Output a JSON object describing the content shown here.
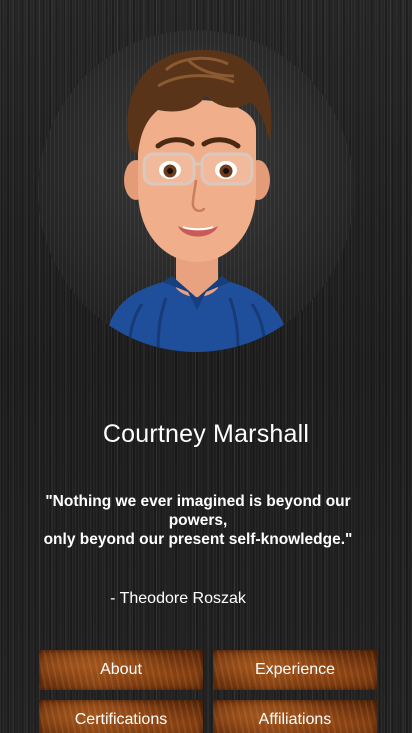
{
  "profile": {
    "name": "Courtney Marshall",
    "quote_line1": "\"Nothing we ever imagined is beyond our powers,",
    "quote_line2": "only beyond our present self-knowledge.\"",
    "author": "- Theodore Roszak"
  },
  "nav": {
    "about": "About",
    "experience": "Experience",
    "certifications": "Certifications",
    "affiliations": "Affiliations"
  },
  "colors": {
    "background": "#1d1d1d",
    "text": "#ffffff",
    "button_wood": "#8a4415",
    "shirt": "#1f4f9a",
    "hair": "#5a3418"
  }
}
